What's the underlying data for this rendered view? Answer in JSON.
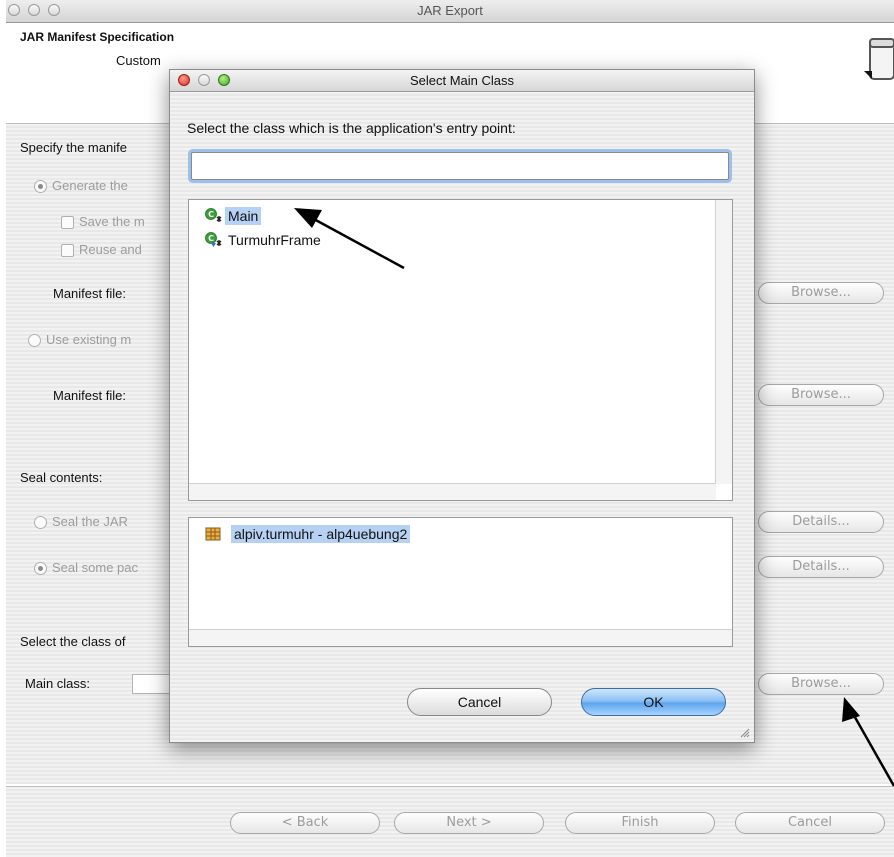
{
  "window": {
    "title": "JAR Export"
  },
  "header": {
    "title": "JAR Manifest Specification",
    "description_partial": "Custom"
  },
  "manifest_section": {
    "label": "Specify the manife",
    "generate_option": "Generate the",
    "save_option": "Save the m",
    "reuse_option": "Reuse and",
    "manifest_file_label": "Manifest file:",
    "browse_label": "Browse...",
    "use_existing_option": "Use existing m",
    "manifest_file_label2": "Manifest file:",
    "browse_label2": "Browse..."
  },
  "seal_section": {
    "label": "Seal contents:",
    "seal_jar_option": "Seal the JAR",
    "details_label": "Details...",
    "seal_some_option": "Seal some pac",
    "details_label2": "Details..."
  },
  "main_class_section": {
    "label": "Select the class of",
    "main_class_label": "Main class:",
    "browse_label": "Browse..."
  },
  "wizard_buttons": {
    "back": "< Back",
    "next": "Next >",
    "finish": "Finish",
    "cancel": "Cancel"
  },
  "dialog": {
    "title": "Select Main Class",
    "prompt": "Select the class which is the application's entry point:",
    "search_value": "",
    "types": [
      {
        "name": "Main",
        "icon": "class-main-icon",
        "selected": true
      },
      {
        "name": "TurmuhrFrame",
        "icon": "class-main-icon",
        "selected": false
      }
    ],
    "packages": [
      {
        "name": "alpiv.turmuhr - alp4uebung2",
        "icon": "package-icon",
        "selected": true
      }
    ],
    "cancel_label": "Cancel",
    "ok_label": "OK"
  },
  "colors": {
    "selection": "#b6d1f3",
    "ok_button": "#5ea5ee",
    "focus_ring": "#9cc0ea"
  }
}
